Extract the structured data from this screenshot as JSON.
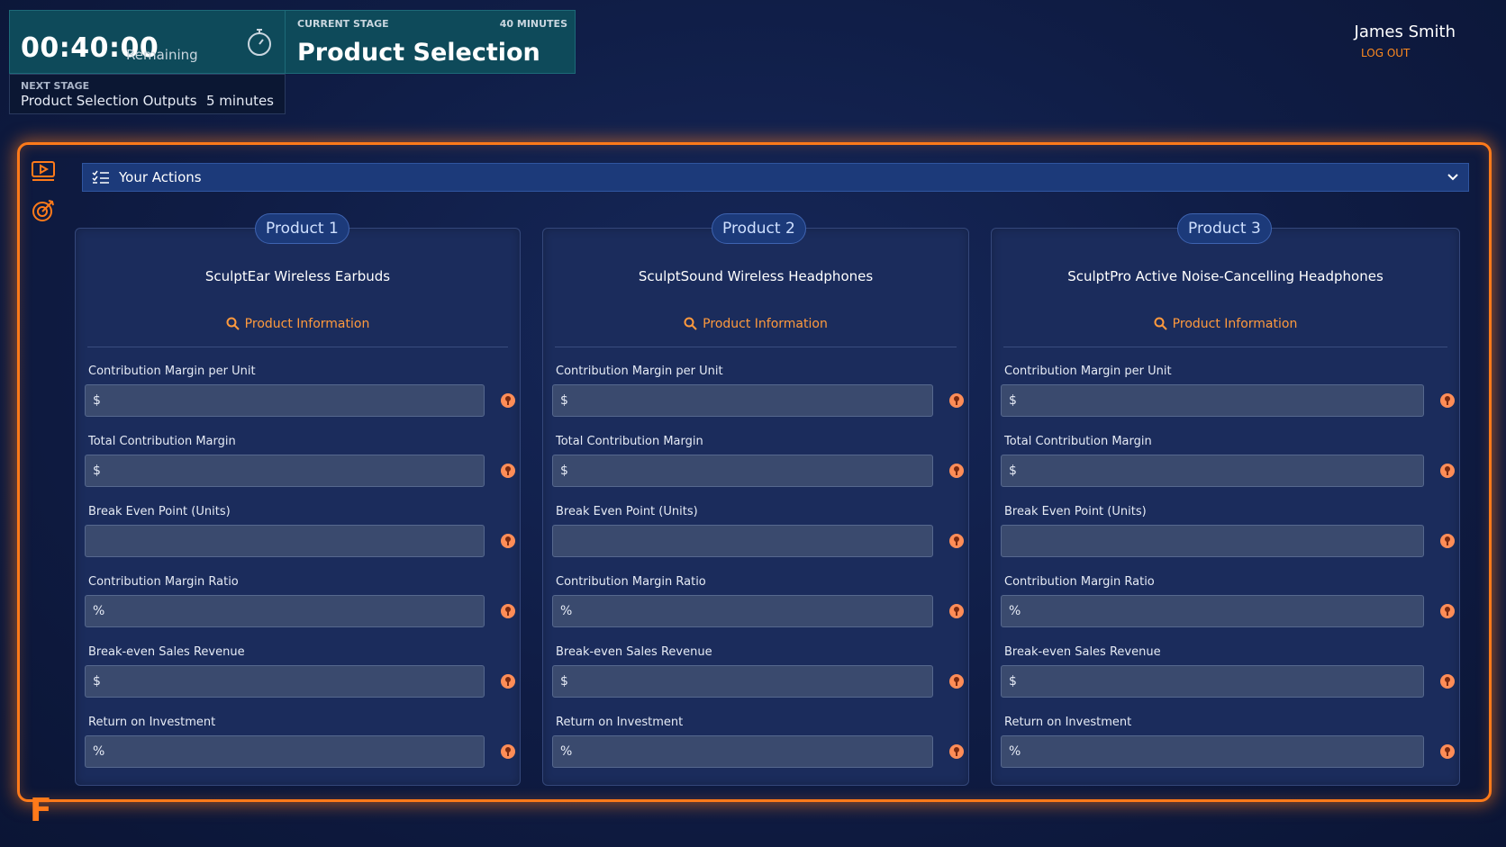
{
  "timer": {
    "time": "00:40:00",
    "remaining_label": "Remaining",
    "next_stage_label": "NEXT STAGE",
    "next_stage_name": "Product Selection Outputs",
    "next_stage_duration": "5 minutes"
  },
  "stage": {
    "label": "CURRENT STAGE",
    "duration": "40 MINUTES",
    "title": "Product Selection"
  },
  "user": {
    "name": "James Smith",
    "logout": "LOG OUT"
  },
  "actions": {
    "title": "Your Actions"
  },
  "field_labels": {
    "f1": "Contribution Margin per Unit",
    "f2": "Total Contribution Margin",
    "f3": "Break Even Point (Units)",
    "f4": "Contribution Margin Ratio",
    "f5": "Break-even Sales Revenue",
    "f6": "Return on Investment"
  },
  "field_prefixes": {
    "f1": "$",
    "f2": "$",
    "f3": "",
    "f4": "%",
    "f5": "$",
    "f6": "%"
  },
  "products": [
    {
      "tag": "Product 1",
      "name": "SculptEar Wireless Earbuds",
      "info_label": "Product Information"
    },
    {
      "tag": "Product 2",
      "name": "SculptSound Wireless Headphones",
      "info_label": "Product Information"
    },
    {
      "tag": "Product 3",
      "name": "SculptPro Active Noise-Cancelling Headphones",
      "info_label": "Product Information"
    }
  ],
  "colors": {
    "accent_orange": "#ff7a1a",
    "panel_teal": "#0e4a5a",
    "hint_icon": "#ff8d57"
  }
}
